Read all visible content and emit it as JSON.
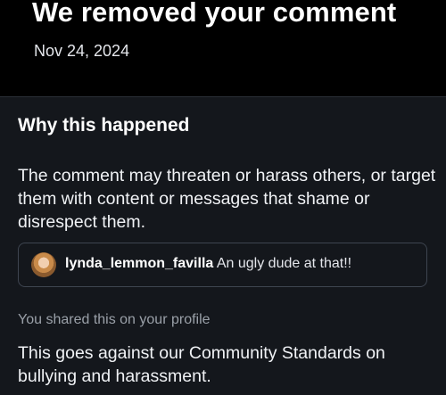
{
  "header": {
    "title": "We removed your comment",
    "date": "Nov 24, 2024"
  },
  "details": {
    "heading": "Why this happened",
    "reason": "The comment may threaten or harass others, or target them with content or messages that shame or disrespect them.",
    "comment": {
      "author": "lynda_lemmon_favilla",
      "text": "An ugly dude at that!!",
      "avatar_icon": "profile-photo"
    },
    "shared_note": "You shared this on your profile",
    "standards_text": "This goes against our Community Standards on bullying and harassment."
  },
  "colors": {
    "background": "#000000",
    "card_background": "#14171c",
    "muted_text": "#9aa0a8",
    "border": "#3e4550"
  }
}
